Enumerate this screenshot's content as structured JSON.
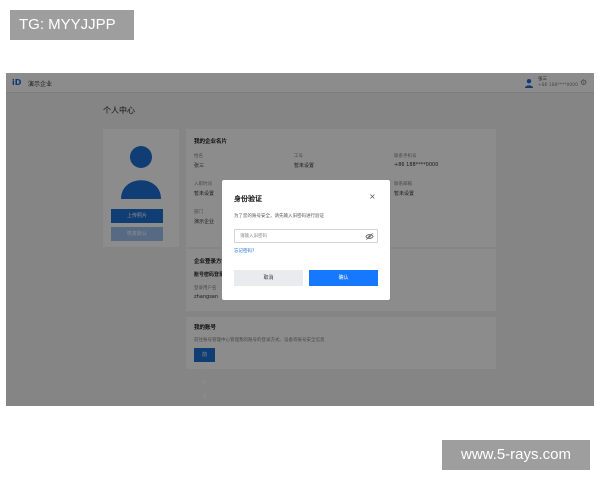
{
  "watermarks": {
    "top_left": "TG: MYYJJPP",
    "bottom_right": "www.5-rays.com"
  },
  "topbar": {
    "logo": "iD",
    "company": "演示企业",
    "user_name": "张三",
    "user_phone": "+86 188****0000",
    "icons": {
      "user": "user-icon",
      "settings": "gear-icon"
    }
  },
  "page_title": "个人中心",
  "avatar_card": {
    "upload_label": "上传照片",
    "recover_label": "恢复默认"
  },
  "card_info": {
    "title": "我的企业名片",
    "fields": [
      {
        "label": "姓名",
        "value": "张三"
      },
      {
        "label": "工号",
        "value": "暂未设置"
      },
      {
        "label": "联系手机号",
        "value": "+86 188****0000"
      },
      {
        "label": "入职时间",
        "value": "暂未设置"
      },
      {
        "label": "联系邮箱",
        "value": "暂未设置"
      },
      {
        "label": "部门",
        "value": "演示企业"
      }
    ]
  },
  "security": {
    "title": "企业登录方式",
    "subtitle": "账号密码登录",
    "label": "登录用户名",
    "value": "zhangsan"
  },
  "account": {
    "title": "我的账号",
    "desc": "前往账号管理中心管理我的账号的登录方式、设备等账号安全信息",
    "button": "前往账号管理中心"
  },
  "dialog": {
    "title": "身份验证",
    "description": "为了您的账号安全，请先输入旧密码进行验证",
    "placeholder": "请输入旧密码",
    "forgot": "忘记密码?",
    "cancel": "取消",
    "confirm": "确认",
    "icons": {
      "close": "close-icon",
      "eye": "eye-off-icon"
    }
  },
  "colors": {
    "accent": "#1677ff",
    "brand": "#1f6fd6",
    "overlay": "rgba(0,0,0,0.45)"
  }
}
